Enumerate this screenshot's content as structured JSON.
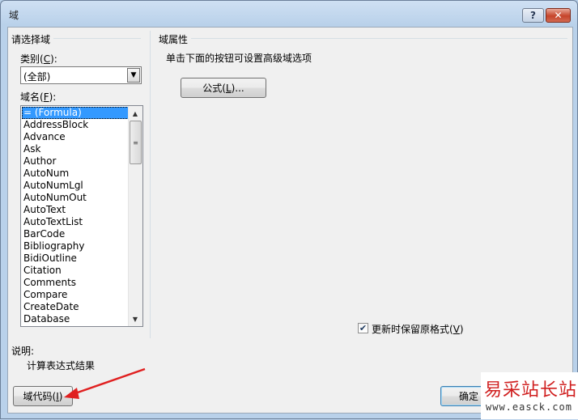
{
  "window": {
    "title": "域",
    "help_label": "?",
    "close_label": "✕"
  },
  "left": {
    "group_title": "请选择域",
    "category_label_pre": "类别(",
    "category_hotkey": "C",
    "category_label_post": "):",
    "category_value": "(全部)",
    "field_names_label_pre": "域名(",
    "field_names_hotkey": "F",
    "field_names_label_post": "):",
    "field_names": [
      "= (Formula)",
      "AddressBlock",
      "Advance",
      "Ask",
      "Author",
      "AutoNum",
      "AutoNumLgl",
      "AutoNumOut",
      "AutoText",
      "AutoTextList",
      "BarCode",
      "Bibliography",
      "BidiOutline",
      "Citation",
      "Comments",
      "Compare",
      "CreateDate",
      "Database"
    ],
    "selected_field": "= (Formula)"
  },
  "right": {
    "group_title": "域属性",
    "instruction": "单击下面的按钮可设置高级域选项",
    "formula_button_pre": "公式(",
    "formula_button_hotkey": "L",
    "formula_button_post": ")...",
    "preserve_format_pre": "更新时保留原格式(",
    "preserve_format_hotkey": "V",
    "preserve_format_post": ")",
    "preserve_format_checked": true
  },
  "description": {
    "label": "说明:",
    "text": "计算表达式结果"
  },
  "footer": {
    "field_codes_pre": "域代码(",
    "field_codes_hotkey": "I",
    "field_codes_post": ")",
    "ok_label": "确定"
  },
  "watermark": {
    "main": "易采站长站",
    "url": "www.easck.com"
  },
  "colors": {
    "selection": "#3399ff",
    "arrow": "#e02020",
    "title_bar": "#b9d1ea"
  }
}
